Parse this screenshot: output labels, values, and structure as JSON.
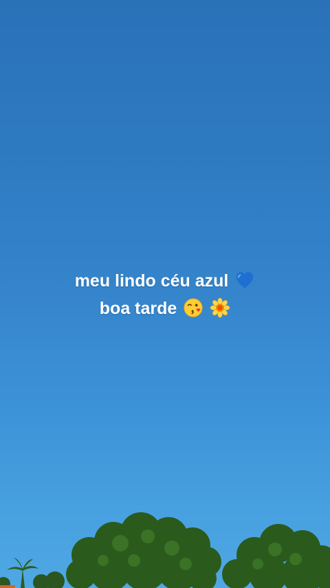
{
  "caption": {
    "line1": "meu lindo céu azul",
    "line1_emoji": "blue-heart-icon",
    "line2": "boa tarde",
    "line2_emojis": [
      "kissing-face-icon",
      "blossom-icon"
    ]
  },
  "colors": {
    "sky_top": "#2a71b8",
    "sky_bottom": "#4fa8e3",
    "text": "#ffffff",
    "foliage": "#2f5a1f"
  }
}
